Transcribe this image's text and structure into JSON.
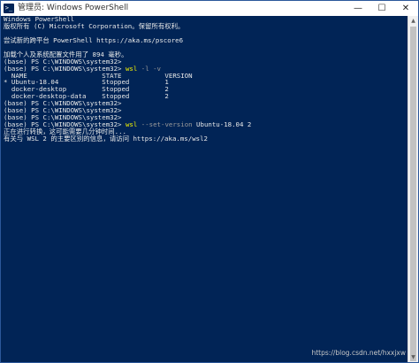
{
  "window": {
    "title": "管理员: Windows PowerShell",
    "icon_label": ">_",
    "controls": {
      "minimize": "—",
      "maximize": "☐",
      "close": "✕"
    }
  },
  "terminal": {
    "lines": [
      "Windows PowerShell",
      "版权所有 (C) Microsoft Corporation。保留所有权利。",
      "",
      "尝试新的跨平台 PowerShell https://aka.ms/pscore6",
      "",
      "加载个人及系统配置文件用了 894 毫秒。",
      "(base) PS C:\\WINDOWS\\system32>",
      {
        "prompt": "(base) PS C:\\WINDOWS\\system32> ",
        "cmd": "wsl",
        "args": " -l -v"
      },
      "  NAME                   STATE           VERSION",
      "* Ubuntu-18.04           Stopped         1",
      "  docker-desktop         Stopped         2",
      "  docker-desktop-data    Stopped         2",
      "(base) PS C:\\WINDOWS\\system32>",
      "(base) PS C:\\WINDOWS\\system32>",
      "(base) PS C:\\WINDOWS\\system32>",
      {
        "prompt": "(base) PS C:\\WINDOWS\\system32> ",
        "cmd": "wsl",
        "args": " --set-version",
        "rest": " Ubuntu-18.04 2"
      },
      "正在进行转换，这可能需要几分钟时间...",
      "有关与 WSL 2 的主要区别的信息，请访问 https://aka.ms/wsl2"
    ]
  },
  "watermark": "https://blog.csdn.net/hxxjxw",
  "colors": {
    "background": "#012456",
    "text": "#e8e8e8",
    "command": "#f2f200",
    "argument": "#9a9a9a"
  }
}
